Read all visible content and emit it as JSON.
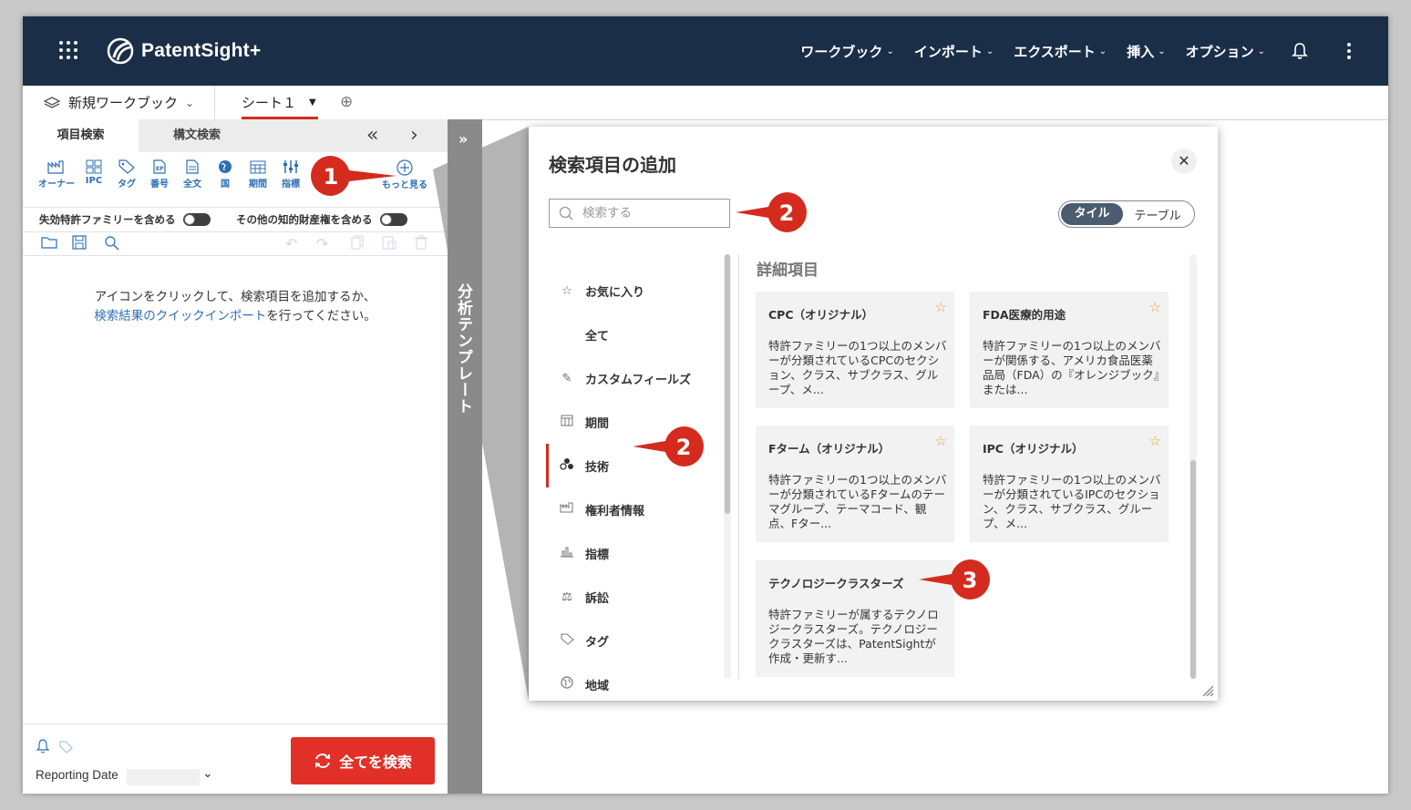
{
  "app": {
    "brand": "PatentSight+",
    "nav": [
      {
        "label": "ワークブック"
      },
      {
        "label": "インポート"
      },
      {
        "label": "エクスポート"
      },
      {
        "label": "挿入"
      },
      {
        "label": "オプション"
      }
    ]
  },
  "tabs": {
    "workbook": "新規ワークブック",
    "sheet": "シート１"
  },
  "left": {
    "tab_active": "項目検索",
    "tab_other": "構文検索",
    "icons": [
      {
        "label": "オーナー",
        "icon": "owner-icon"
      },
      {
        "label": "IPC",
        "icon": "ipc-icon"
      },
      {
        "label": "タグ",
        "icon": "tag-icon"
      },
      {
        "label": "番号",
        "icon": "number-icon"
      },
      {
        "label": "全文",
        "icon": "fulltext-icon"
      },
      {
        "label": "国",
        "icon": "globe-icon"
      },
      {
        "label": "期間",
        "icon": "calendar-icon"
      },
      {
        "label": "指標",
        "icon": "indicator-icon"
      }
    ],
    "more": "もっと見る",
    "toggle1": "失効特許ファミリーを含める",
    "toggle2": "その他の知的財産権を含める",
    "empty_line1": "アイコンをクリックして、検索項目を追加するか、",
    "empty_link": "検索結果のクイックインポート",
    "empty_line2_rest": "を行ってください。",
    "reporting_date": "Reporting Date",
    "search_all": "全てを検索"
  },
  "strip": {
    "label": "分析テンプレート"
  },
  "modal": {
    "title": "検索項目の追加",
    "search_placeholder": "検索する",
    "view_tile": "タイル",
    "view_table": "テーブル",
    "categories": [
      {
        "label": "お気に入り",
        "icon": "star-icon"
      },
      {
        "label": "全て",
        "icon": ""
      },
      {
        "label": "カスタムフィールズ",
        "icon": "pencil-icon"
      },
      {
        "label": "期間",
        "icon": "calendar-icon"
      },
      {
        "label": "技術",
        "icon": "technology-icon"
      },
      {
        "label": "権利者情報",
        "icon": "owner-icon"
      },
      {
        "label": "指標",
        "icon": "indicator-icon"
      },
      {
        "label": "訴訟",
        "icon": "scales-icon"
      },
      {
        "label": "タグ",
        "icon": "tag-icon"
      },
      {
        "label": "地域",
        "icon": "globe-icon"
      }
    ],
    "active_category": "技術",
    "detail_title": "詳細項目",
    "cards": [
      {
        "title": "CPC（オリジナル）",
        "desc": "特許ファミリーの1つ以上のメンバーが分類されているCPCのセクション、クラス、サブクラス、グループ、メ..."
      },
      {
        "title": "FDA医療的用途",
        "desc": "特許ファミリーの1つ以上のメンバーが関係する、アメリカ食品医薬品局（FDA）の『オレンジブック』または..."
      },
      {
        "title": "Fターム（オリジナル）",
        "desc": "特許ファミリーの1つ以上のメンバーが分類されているFタームのテーマグループ、テーマコード、観点、Fター..."
      },
      {
        "title": "IPC（オリジナル）",
        "desc": "特許ファミリーの1つ以上のメンバーが分類されているIPCのセクション、クラス、サブクラス、グループ、メ..."
      },
      {
        "title": "テクノロジークラスターズ",
        "desc": "特許ファミリーが属するテクノロジークラスターズ。テクノロジークラスターズは、PatentSightが作成・更新す..."
      }
    ]
  },
  "callouts": [
    "1",
    "2",
    "2",
    "3"
  ],
  "colors": {
    "header_bg": "#1b2e48",
    "accent_red": "#e03028",
    "link_blue": "#2c6fb7"
  }
}
